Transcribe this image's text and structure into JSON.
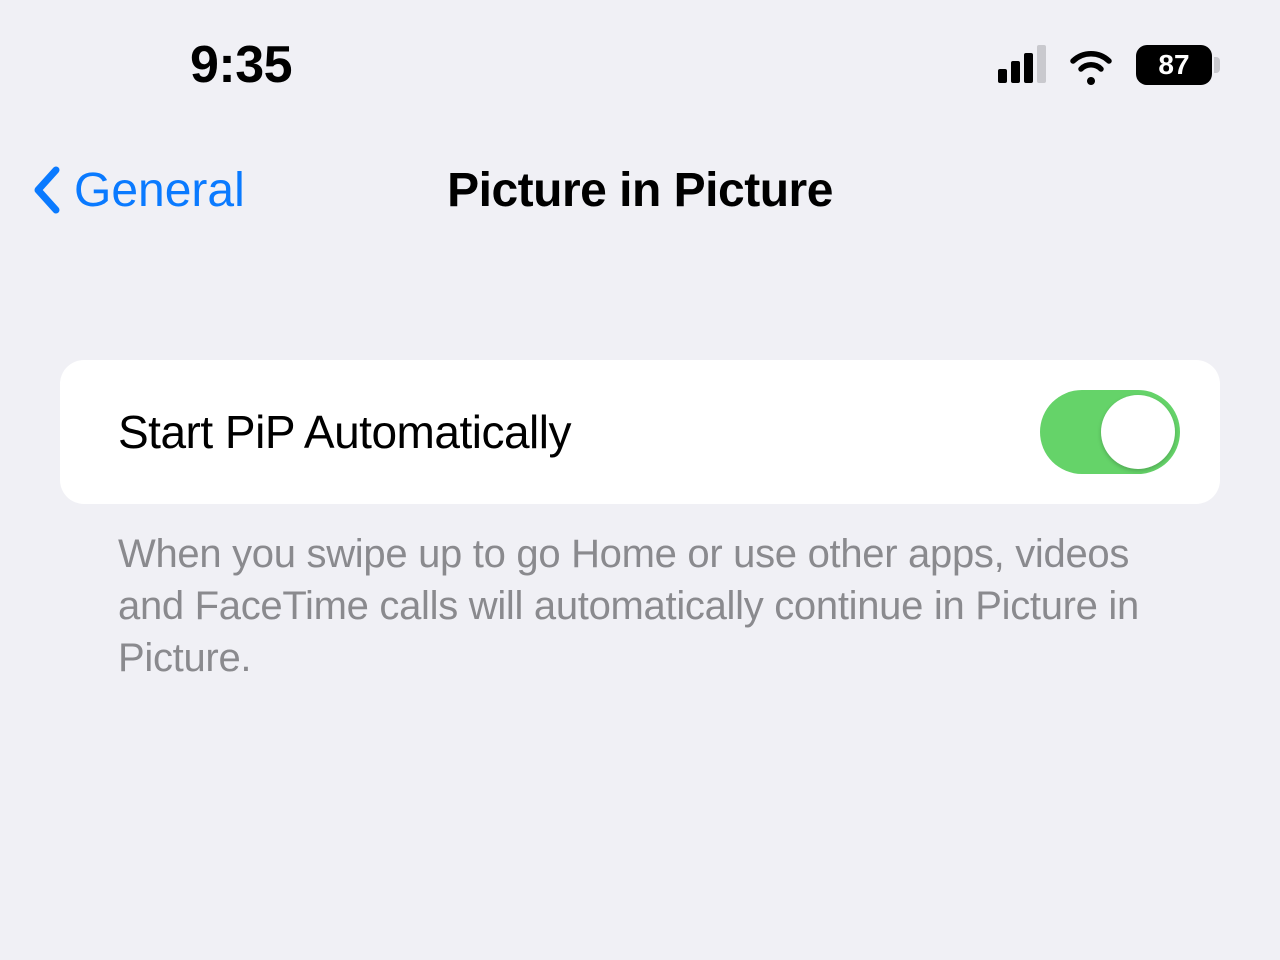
{
  "status": {
    "time": "9:35",
    "battery": "87"
  },
  "nav": {
    "back_label": "General",
    "title": "Picture in Picture"
  },
  "setting": {
    "label": "Start PiP Automatically",
    "enabled": true,
    "footer": "When you swipe up to go Home or use other apps, videos and FaceTime calls will automatically continue in Picture in Picture."
  }
}
